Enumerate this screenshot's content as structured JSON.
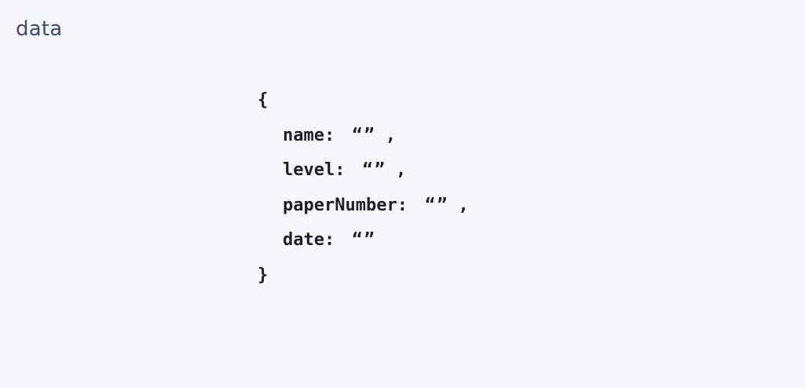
{
  "title": "data",
  "code": {
    "open_brace": "{",
    "close_brace": "}",
    "fields": [
      {
        "key": "name:",
        "value": "“”",
        "comma": ","
      },
      {
        "key": "level:",
        "value": "“”",
        "comma": ","
      },
      {
        "key": "paperNumber:",
        "value": "“”",
        "comma": ","
      },
      {
        "key": "date:",
        "value": "“”",
        "comma": ""
      }
    ]
  }
}
